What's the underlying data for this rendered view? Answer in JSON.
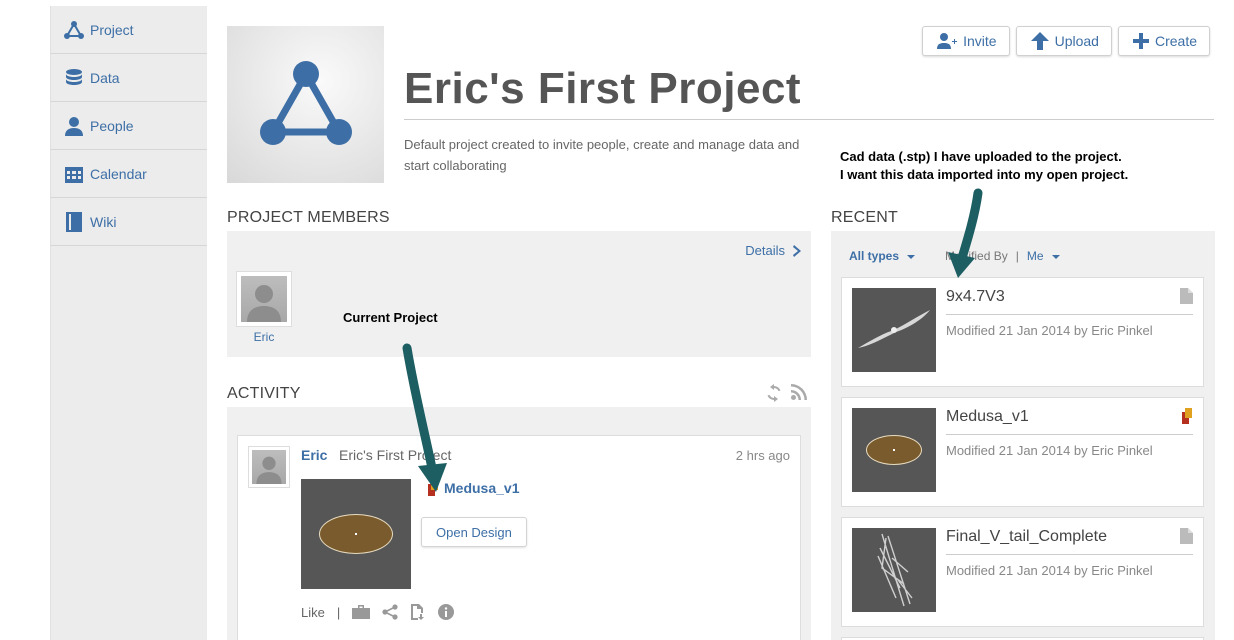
{
  "sidebar": {
    "items": [
      {
        "label": "Project",
        "icon": "project-icon"
      },
      {
        "label": "Data",
        "icon": "database-icon"
      },
      {
        "label": "People",
        "icon": "person-icon"
      },
      {
        "label": "Calendar",
        "icon": "calendar-icon"
      },
      {
        "label": "Wiki",
        "icon": "book-icon"
      }
    ]
  },
  "toolbar": {
    "invite_label": "Invite",
    "upload_label": "Upload",
    "create_label": "Create"
  },
  "project": {
    "title": "Eric's First Project",
    "description": "Default project created to invite people, create and manage data and start collaborating"
  },
  "members": {
    "heading": "PROJECT MEMBERS",
    "details_label": "Details",
    "list": [
      {
        "name": "Eric"
      }
    ]
  },
  "activity": {
    "heading": "ACTIVITY",
    "entry": {
      "user": "Eric",
      "project": "Eric's First Project",
      "time": "2 hrs ago",
      "design_name": "Medusa_v1",
      "open_design_label": "Open Design",
      "like_label": "Like",
      "separator": "|"
    }
  },
  "recent": {
    "heading": "RECENT",
    "filter_type": "All types",
    "modified_by_label": "Modified By",
    "separator": "|",
    "modified_by_value": "Me",
    "items": [
      {
        "name": "9x4.7V3",
        "meta": "Modified 21 Jan 2014 by Eric Pinkel",
        "type_icon": "file-icon"
      },
      {
        "name": "Medusa_v1",
        "meta": "Modified 21 Jan 2014 by Eric Pinkel",
        "type_icon": "fusion-design-icon"
      },
      {
        "name": "Final_V_tail_Complete",
        "meta": "Modified 21 Jan 2014 by Eric Pinkel",
        "type_icon": "file-icon"
      }
    ]
  },
  "annotations": {
    "cad_line1": "Cad data (.stp) I have uploaded to the project.",
    "cad_line2": "I want this data imported into my open project.",
    "current_project": "Current Project"
  },
  "colors": {
    "accent": "#3d6fa6",
    "sidebar_bg": "#ececec",
    "panel_bg": "#f0f0f0",
    "arrow": "#1d5e63"
  }
}
